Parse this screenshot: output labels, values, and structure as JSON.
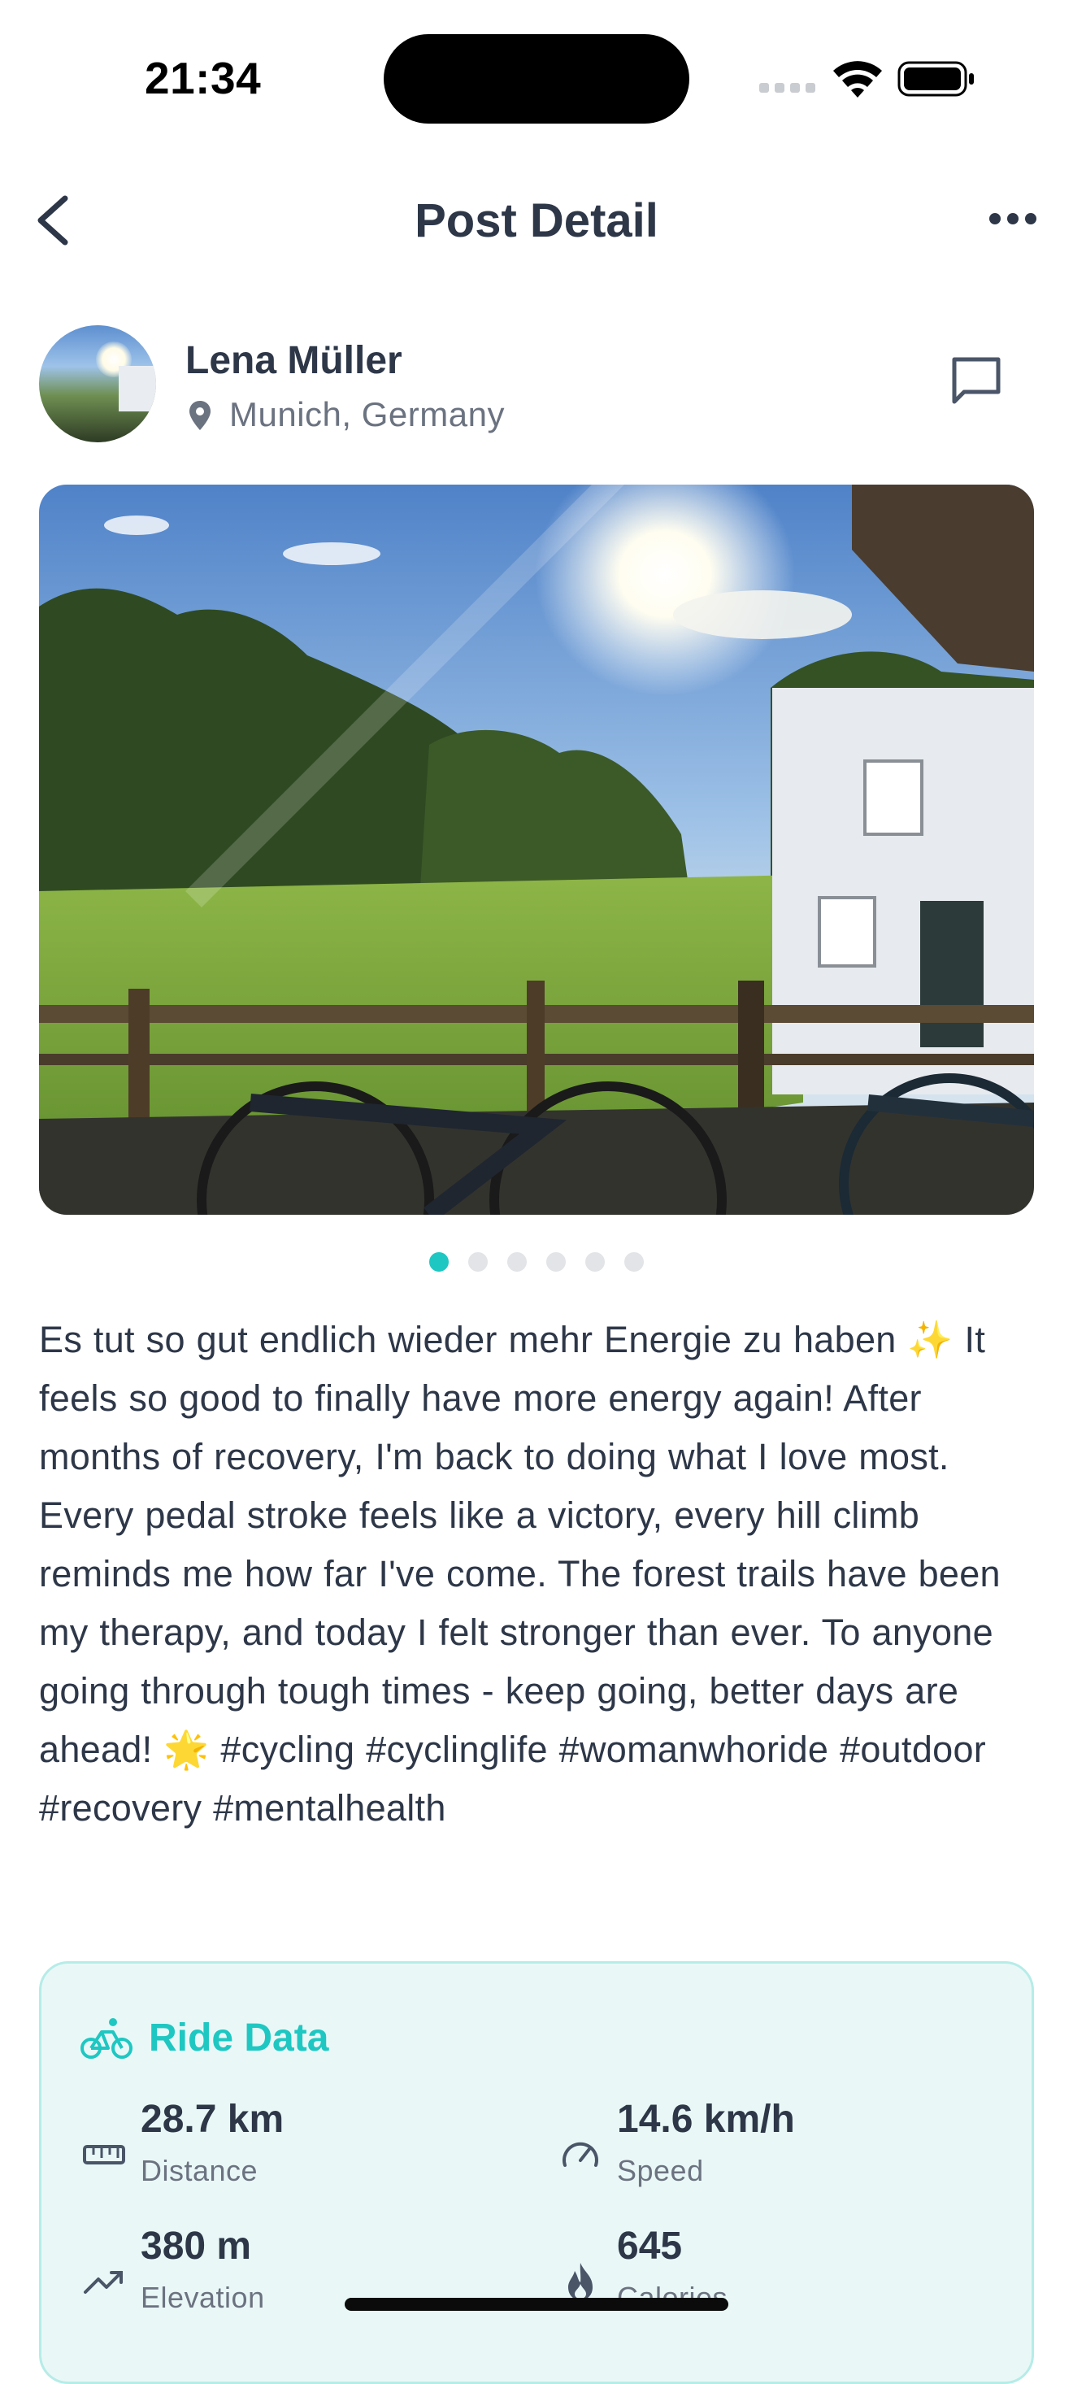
{
  "status_bar": {
    "time": "21:34"
  },
  "header": {
    "title": "Post Detail"
  },
  "author": {
    "name": "Lena Müller",
    "location": "Munich, Germany"
  },
  "carousel": {
    "total": 6,
    "active_index": 0
  },
  "caption": "Es tut so gut endlich wieder mehr Energie zu haben ✨  It feels so good to finally have more energy again! After months of recovery, I'm back to doing what I love most. Every pedal stroke feels like a victory, every hill climb reminds me how far I've come. The forest trails have been my therapy, and today I felt stronger than ever. To anyone going through tough times - keep going, better days are ahead! 🌟  #cycling #cyclinglife #womanwhoride #outdoor #recovery #mentalhealth",
  "ride_data": {
    "title": "Ride Data",
    "distance": {
      "value": "28.7 km",
      "label": "Distance"
    },
    "speed": {
      "value": "14.6 km/h",
      "label": "Speed"
    },
    "elevation": {
      "value": "380 m",
      "label": "Elevation"
    },
    "calories": {
      "value": "645",
      "label": "Calories"
    }
  },
  "colors": {
    "accent": "#1fc7c2",
    "text_primary": "#2d3748",
    "text_secondary": "#6b7280",
    "card_background": "#e9f8f7",
    "card_border": "#b6ece8"
  },
  "icons": {
    "back": "chevron-left-icon",
    "more": "more-horizontal-icon",
    "location": "map-pin-icon",
    "comment": "comment-icon",
    "bike": "bicycle-icon",
    "distance": "ruler-icon",
    "speed": "speedometer-icon",
    "elevation": "trending-up-icon",
    "calories": "flame-icon"
  }
}
